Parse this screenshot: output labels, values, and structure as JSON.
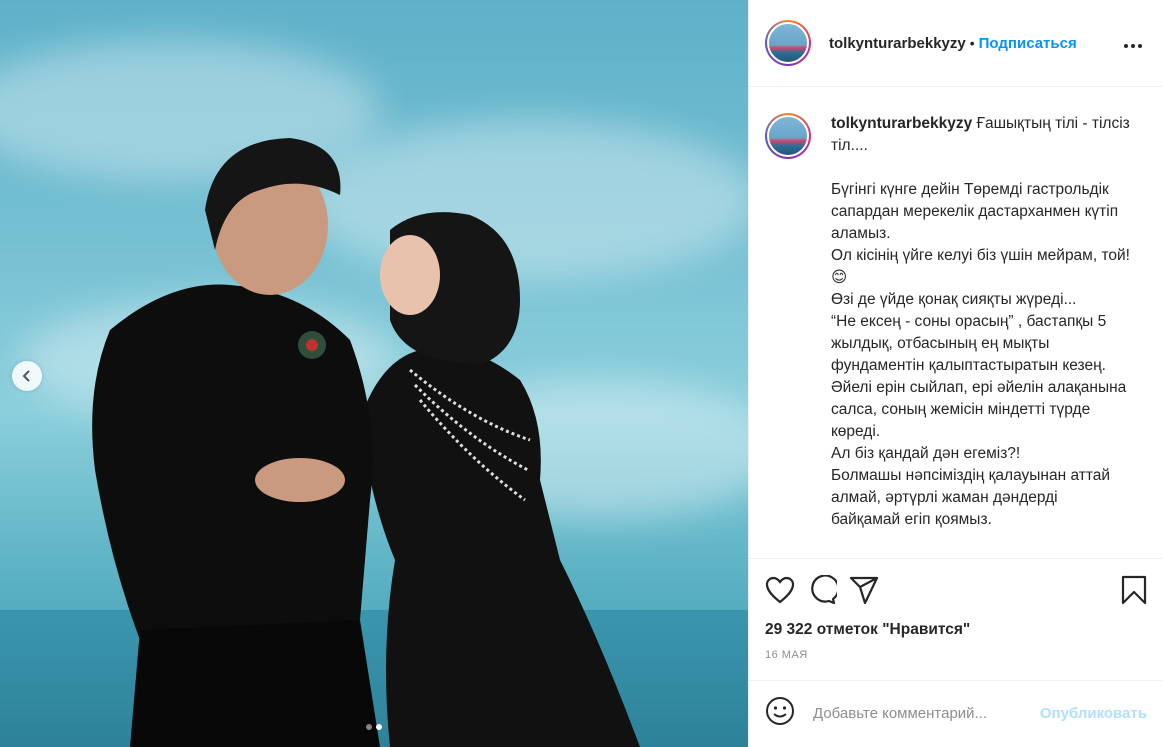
{
  "post": {
    "username": "tolkynturarbekkyzy",
    "separator": "•",
    "follow_label": "Подписаться",
    "more_label": "•••"
  },
  "caption": {
    "username": "tolkynturarbekkyzy",
    "text": "Ғашықтың тілі - тілсіз тіл....\n\nБүгінгі күнге дейін Төремді гастрольдік сапардан мерекелік дастарханмен күтіп аламыз.\nОл кісінің үйге келуі біз үшін мейрам, той!😊\nӨзі де үйде қонақ сияқты жүреді...\n“Не ексең - соны орасың” , бастапқы 5 жылдық, отбасының ең мықты фундаментін қалыптастыратын кезең.\nӘйелі ерін сыйлап, ері әйелін алақанына салса, соның жемісін міндетті түрде көреді.\nАл біз қандай дән егеміз?!\nБолмашы нәпсіміздің қалауынан аттай алмай, әртүрлі жаман дәндерді байқамай егіп қоямыз."
  },
  "stats": {
    "likes": "29 322 отметок \"Нравится\"",
    "date": "16 МАЯ"
  },
  "comment_box": {
    "placeholder": "Добавьте комментарий...",
    "publish_label": "Опубликовать"
  },
  "carousel": {
    "dots": 2,
    "active_index": 1
  },
  "icons": {
    "like": "heart-icon",
    "comment": "comment-icon",
    "share": "share-icon",
    "save": "bookmark-icon",
    "emoji": "emoji-icon",
    "prev": "chevron-left-icon"
  },
  "colors": {
    "accent": "#0095f6",
    "publish_disabled": "#b2dffc",
    "muted": "#8e8e8e"
  }
}
